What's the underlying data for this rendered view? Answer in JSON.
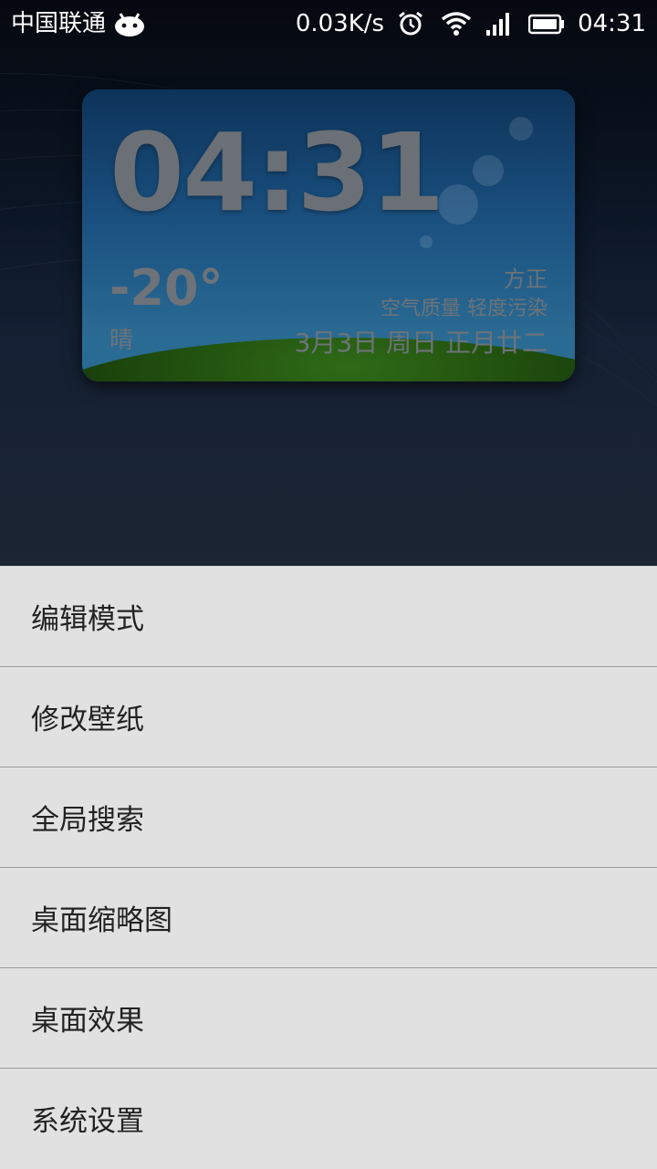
{
  "status_bar": {
    "carrier": "中国联通",
    "net_speed": "0.03K/s",
    "time": "04:31",
    "icons": [
      "android-icon",
      "alarm-icon",
      "wifi-icon",
      "signal-icon",
      "battery-icon"
    ]
  },
  "widget": {
    "clock": "04:31",
    "temperature": "-20°",
    "weather": "晴",
    "city": "方正",
    "air_quality": "空气质量 轻度污染",
    "date": "3月3日 周日 正月廿二"
  },
  "menu": {
    "items": [
      {
        "label": "编辑模式"
      },
      {
        "label": "修改壁纸"
      },
      {
        "label": "全局搜索"
      },
      {
        "label": "桌面缩略图"
      },
      {
        "label": "桌面效果"
      },
      {
        "label": "系统设置"
      }
    ]
  },
  "colors": {
    "menu_bg": "#e1e1e1",
    "divider": "#9b9b9b",
    "text": "#222222"
  }
}
